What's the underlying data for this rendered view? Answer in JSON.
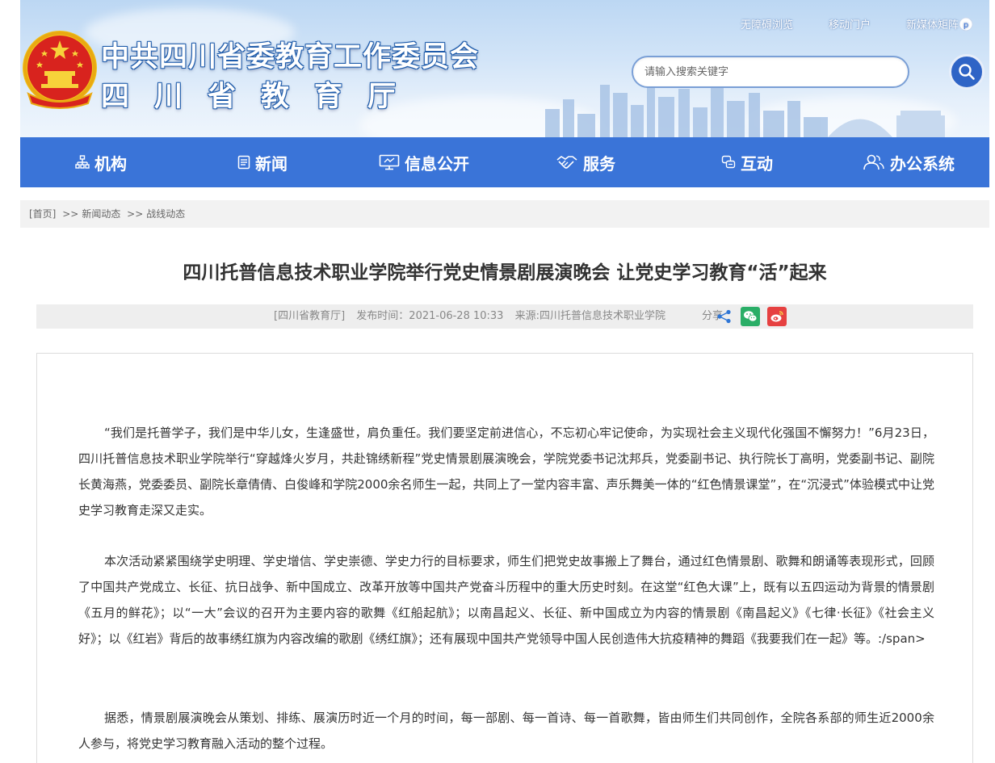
{
  "header": {
    "org_title": "中共四川省委教育工作委员会",
    "dept_title": "四川省教育厅",
    "top_links": [
      "无障碍浏览",
      "移动门户",
      "新媒体矩阵"
    ],
    "search_placeholder": "请输入搜索关键字"
  },
  "nav": {
    "items": [
      {
        "label": "机构",
        "icon": "org-chart-icon"
      },
      {
        "label": "新闻",
        "icon": "newspaper-icon"
      },
      {
        "label": "信息公开",
        "icon": "monitor-icon"
      },
      {
        "label": "服务",
        "icon": "handshake-icon"
      },
      {
        "label": "互动",
        "icon": "chat-icon"
      },
      {
        "label": "办公系统",
        "icon": "users-icon"
      }
    ]
  },
  "breadcrumb": {
    "home": "[首页]",
    "sep": ">>",
    "level1": "新闻动态",
    "level2": "战线动态"
  },
  "article": {
    "title": "四川托普信息技术职业学院举行党史情景剧展演晚会 让党史学习教育“活”起来",
    "site": "[四川省教育厅]",
    "publish_time": "发布时间：2021-06-28 10:33",
    "source": "来源:四川托普信息技术职业学院",
    "share_label": "分享",
    "paragraphs": [
      "“我们是托普学子，我们是中华儿女，生逢盛世，肩负重任。我们要坚定前进信心，不忘初心牢记使命，为实现社会主义现代化强国不懈努力！”6月23日，四川托普信息技术职业学院举行“穿越烽火岁月，共赴锦绣新程”党史情景剧展演晚会，学院党委书记沈邦兵，党委副书记、执行院长丁高明，党委副书记、副院长黄海燕，党委委员、副院长章倩倩、白俊峰和学院2000余名师生一起，共同上了一堂内容丰富、声乐舞美一体的“红色情景课堂”，在“沉浸式”体验模式中让党史学习教育走深又走实。",
      "本次活动紧紧围绕学史明理、学史增信、学史崇德、学史力行的目标要求，师生们把党史故事搬上了舞台，通过红色情景剧、歌舞和朗诵等表现形式，回顾了中国共产党成立、长征、抗日战争、新中国成立、改革开放等中国共产党奋斗历程中的重大历史时刻。在这堂“红色大课”上，既有以五四运动为背景的情景剧《五月的鲜花》；以“一大”会议的召开为主要内容的歌舞《红船起航》；以南昌起义、长征、新中国成立为内容的情景剧《南昌起义》《七律·长征》《社会主义好》；以《红岩》背后的故事绣红旗为内容改编的歌剧《绣红旗》；还有展现中国共产党领导中国人民创造伟大抗疫精神的舞蹈《我要我们在一起》等。:/span>",
      "据悉，情景剧展演晚会从策划、排练、展演历时近一个月的时间，每一部剧、每一首诗、每一首歌舞，皆由师生们共同创作，全院各系部的师生近2000余人参与，将党史学习教育融入活动的整个过程。"
    ]
  },
  "colors": {
    "nav_bg": "#3a74d8",
    "search_btn": "#2f64c6",
    "wechat": "#2aae67",
    "weibo": "#e64141"
  }
}
